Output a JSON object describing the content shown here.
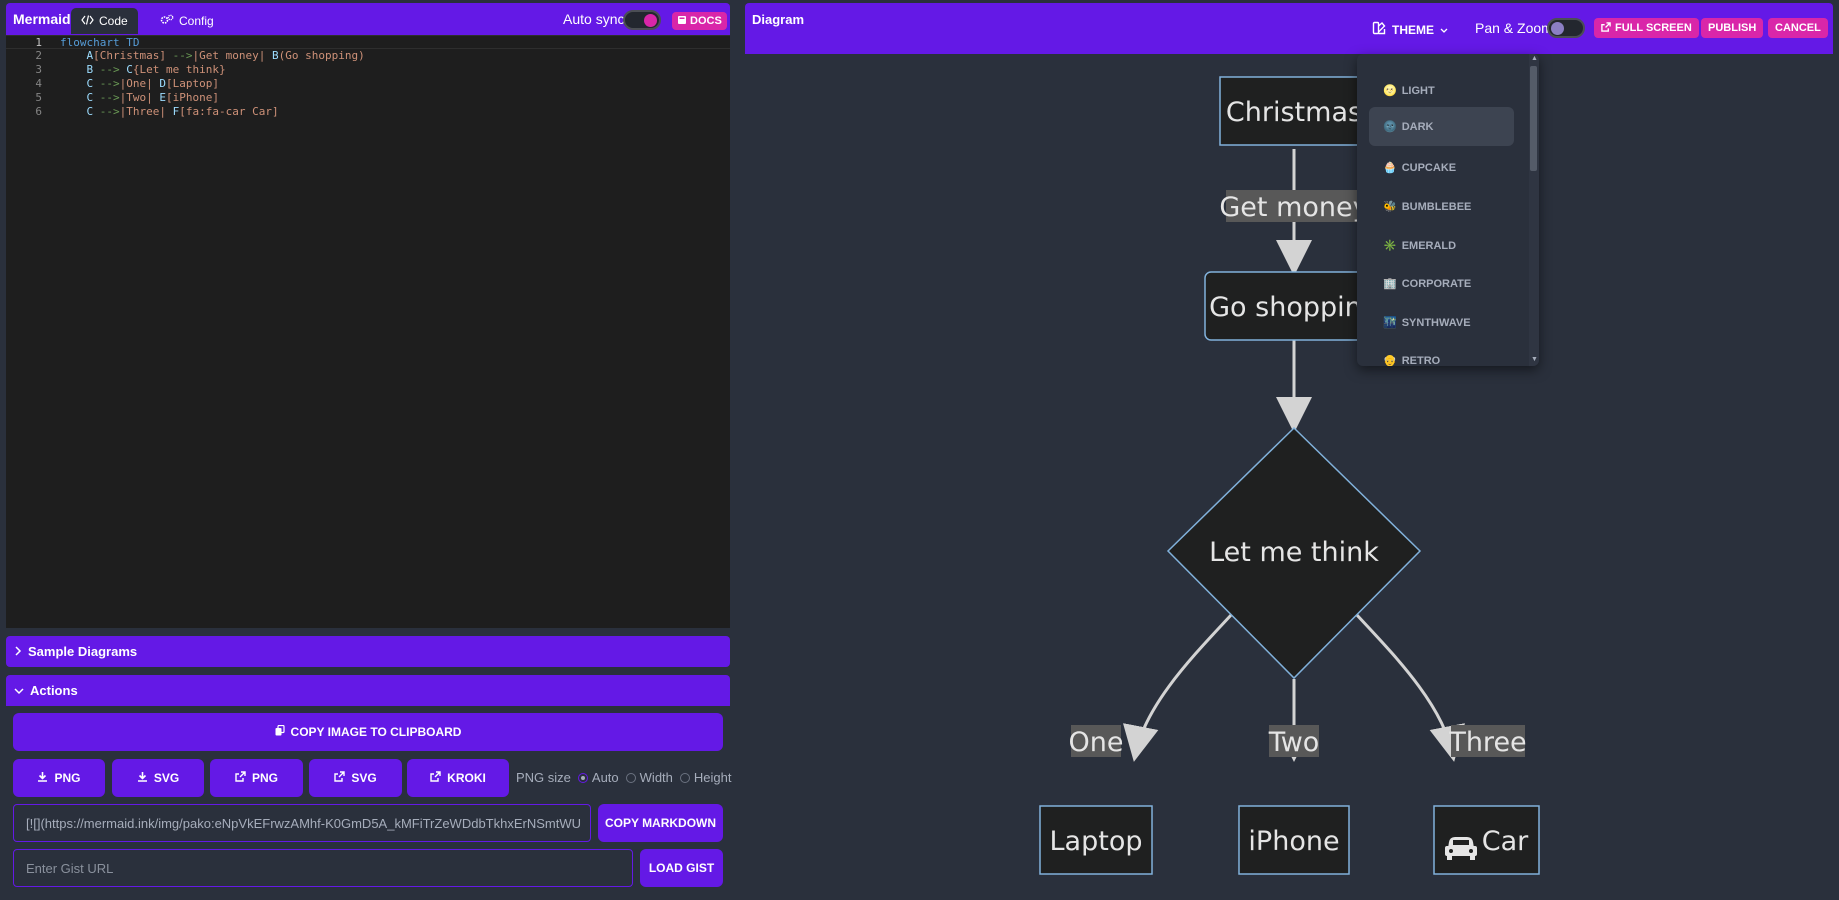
{
  "left": {
    "brand": "Mermaid",
    "tabs": [
      {
        "label": "Code",
        "icon": "code-icon"
      },
      {
        "label": "Config",
        "icon": "gears-icon"
      }
    ],
    "autosync_label": "Auto sync",
    "autosync_on": true,
    "docs_label": "DOCS"
  },
  "editor": {
    "lines": [
      {
        "n": "1",
        "text": "flowchart TD"
      },
      {
        "n": "2",
        "text": "    A[Christmas] -->|Get money| B(Go shopping)"
      },
      {
        "n": "3",
        "text": "    B --> C{Let me think}"
      },
      {
        "n": "4",
        "text": "    C -->|One| D[Laptop]"
      },
      {
        "n": "5",
        "text": "    C -->|Two| E[iPhone]"
      },
      {
        "n": "6",
        "text": "    C -->|Three| F[fa:fa-car Car]"
      }
    ]
  },
  "accordions": {
    "samples": "Sample Diagrams",
    "actions": "Actions"
  },
  "actions": {
    "copy_image": "COPY IMAGE TO CLIPBOARD",
    "dl_png": "PNG",
    "dl_svg": "SVG",
    "open_png": "PNG",
    "open_svg": "SVG",
    "kroki": "KROKI",
    "png_size_label": "PNG size",
    "png_size_options": [
      "Auto",
      "Width",
      "Height"
    ],
    "png_size_selected": "Auto",
    "markdown_value": "[![](https://mermaid.ink/img/pako:eNpVkEFrwzAMhf-K0GmD5A_kMFiTrZeWDdbTkhxErNSmtWU",
    "copy_markdown": "COPY MARKDOWN",
    "gist_placeholder": "Enter Gist URL",
    "load_gist": "LOAD GIST"
  },
  "right": {
    "title": "Diagram",
    "theme_label": "THEME",
    "panzoom_label": "Pan & Zoom",
    "panzoom_on": false,
    "fullscreen": "FULL SCREEN",
    "publish": "PUBLISH",
    "cancel": "CANCEL"
  },
  "diagram": {
    "nodes": {
      "christmas": "Christmas",
      "go_shopping": "Go shopping",
      "let_me_think": "Let me think",
      "laptop": "Laptop",
      "iphone": "iPhone",
      "car": "Car"
    },
    "edges": {
      "get_money": "Get money",
      "one": "One",
      "two": "Two",
      "three": "Three"
    }
  },
  "theme_menu": {
    "items": [
      {
        "label": "LIGHT",
        "emoji": "🌝"
      },
      {
        "label": "DARK",
        "emoji": "🌚"
      },
      {
        "label": "CUPCAKE",
        "emoji": "🧁"
      },
      {
        "label": "BUMBLEBEE",
        "emoji": "🐝"
      },
      {
        "label": "EMERALD",
        "emoji": "✳️"
      },
      {
        "label": "CORPORATE",
        "emoji": "🏢"
      },
      {
        "label": "SYNTHWAVE",
        "emoji": "🌃"
      },
      {
        "label": "RETRO",
        "emoji": "👴"
      }
    ],
    "selected": "DARK"
  },
  "colors": {
    "primary": "#6419e6",
    "secondary": "#d926a9",
    "base": "#2a303c",
    "editor_bg": "#1e1e1e",
    "node_fill": "#1f2020",
    "node_stroke": "#81b1db",
    "edge": "#d3d3d3"
  }
}
